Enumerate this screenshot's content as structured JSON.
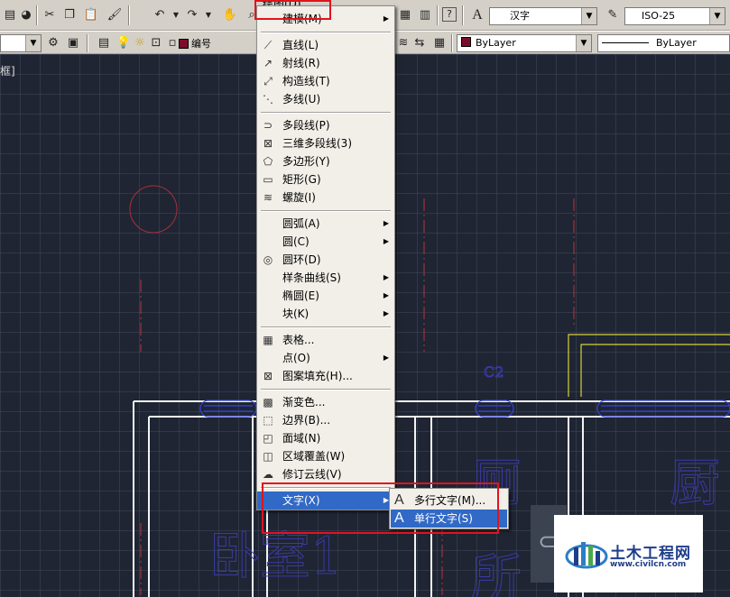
{
  "menubar": {
    "active_menu": "绘图(D)"
  },
  "toolbar_top": {
    "text_style": "汉字",
    "dim_style": "ISO-25"
  },
  "toolbar_layers": {
    "layer_name": "编号",
    "color_value": "ByLayer",
    "linetype_value": "ByLayer",
    "layer_color": "#7a0e2a"
  },
  "canvas": {
    "viewport_label": "框]",
    "room_labels": [
      "卧室1",
      "厕",
      "所",
      "厨"
    ],
    "room_number": "C2"
  },
  "draw_menu": {
    "items": [
      {
        "label": "建模(M)",
        "submenu": true
      },
      {
        "label": "直线(L)"
      },
      {
        "label": "射线(R)"
      },
      {
        "label": "构造线(T)"
      },
      {
        "label": "多线(U)"
      },
      {
        "label": "多段线(P)"
      },
      {
        "label": "三维多段线(3)"
      },
      {
        "label": "多边形(Y)"
      },
      {
        "label": "矩形(G)"
      },
      {
        "label": "螺旋(I)"
      },
      {
        "label": "圆弧(A)",
        "submenu": true
      },
      {
        "label": "圆(C)",
        "submenu": true
      },
      {
        "label": "圆环(D)"
      },
      {
        "label": "样条曲线(S)",
        "submenu": true
      },
      {
        "label": "椭圆(E)",
        "submenu": true
      },
      {
        "label": "块(K)",
        "submenu": true
      },
      {
        "label": "表格..."
      },
      {
        "label": "点(O)",
        "submenu": true
      },
      {
        "label": "图案填充(H)..."
      },
      {
        "label": "渐变色..."
      },
      {
        "label": "边界(B)..."
      },
      {
        "label": "面域(N)"
      },
      {
        "label": "区域覆盖(W)"
      },
      {
        "label": "修订云线(V)"
      },
      {
        "label": "文字(X)",
        "submenu": true,
        "highlighted": true
      }
    ]
  },
  "text_submenu": {
    "items": [
      {
        "label": "多行文字(M)..."
      },
      {
        "label": "单行文字(S)",
        "highlighted": true
      }
    ]
  },
  "watermark": {
    "title": "土木工程网",
    "url": "www.civilcn.com"
  },
  "colors": {
    "highlight": "#3169c6",
    "annotation_red": "#e0141e",
    "canvas_bg": "#1f2533"
  }
}
